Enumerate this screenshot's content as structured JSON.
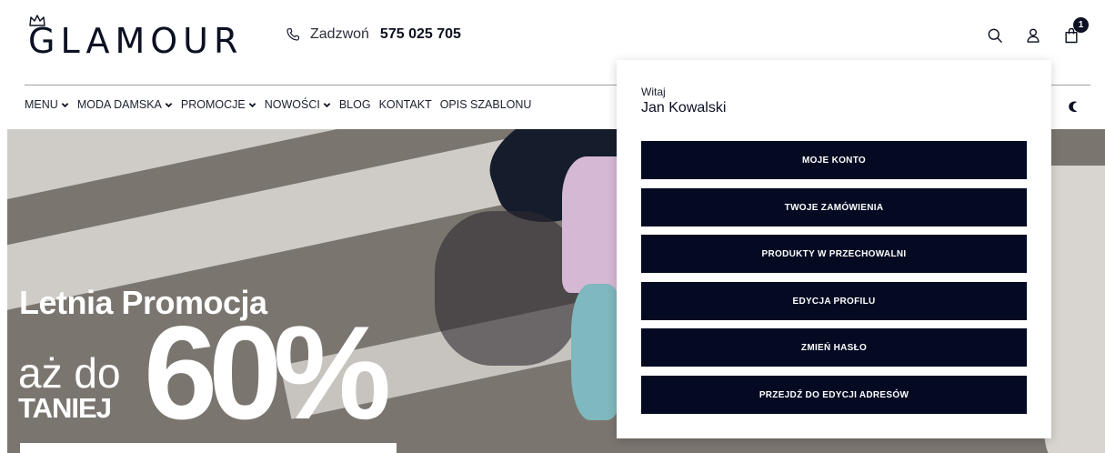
{
  "header": {
    "logo_text": "GLAMOUR",
    "phone_label": "Zadzwoń",
    "phone_number": "575 025 705",
    "cart_count": "1",
    "icons": [
      "search-icon",
      "user-icon",
      "cart-icon",
      "phone-icon",
      "crown-icon"
    ]
  },
  "nav": {
    "items": [
      {
        "label": "MENU",
        "has_dropdown": true
      },
      {
        "label": "MODA DAMSKA",
        "has_dropdown": true
      },
      {
        "label": "PROMOCJE",
        "has_dropdown": true
      },
      {
        "label": "NOWOŚCI",
        "has_dropdown": true
      },
      {
        "label": "BLOG",
        "has_dropdown": false
      },
      {
        "label": "KONTAKT",
        "has_dropdown": false
      },
      {
        "label": "OPIS SZABLONU",
        "has_dropdown": false
      }
    ],
    "theme_icon": "moon-icon"
  },
  "hero": {
    "title": "Letnia Promocja",
    "upto": "aż do",
    "cheaper": "TANIEJ",
    "percent": "60%"
  },
  "account_menu": {
    "greeting": "Witaj",
    "user_name": "Jan Kowalski",
    "buttons": [
      "MOJE KONTO",
      "TWOJE ZAMÓWIENIA",
      "PRODUKTY W PRZECHOWALNI",
      "EDYCJA PROFILU",
      "ZMIEŃ HASŁO",
      "PRZEJDŹ DO EDYCJI ADRESÓW"
    ]
  },
  "colors": {
    "brand_dark": "#030a22",
    "text": "#0b1022",
    "white": "#ffffff"
  }
}
